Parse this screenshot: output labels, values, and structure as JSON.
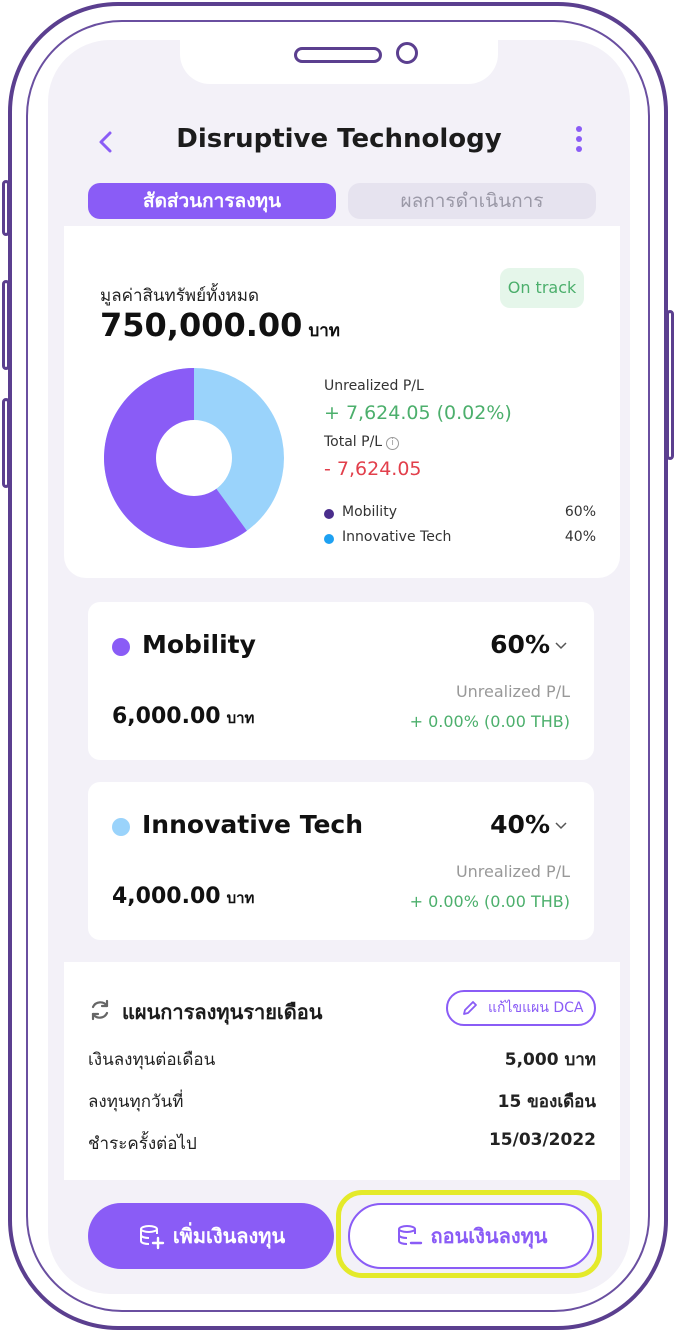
{
  "header": {
    "title": "Disruptive Technology"
  },
  "tabs": [
    {
      "label": "สัดส่วนการลงทุน",
      "active": true
    },
    {
      "label": "ผลการดำเนินการ",
      "active": false
    }
  ],
  "summary": {
    "total_label": "มูลค่าสินทรัพย์ทั้งหมด",
    "total_value": "750,000.00",
    "total_unit": "บาท",
    "status": "On track",
    "unrealized_label": "Unrealized P/L",
    "unrealized_value": "+ 7,624.05 (0.02%)",
    "total_pl_label": "Total P/L",
    "total_pl_value": "- 7,624.05",
    "legend": [
      {
        "name": "Mobility",
        "percent": "60%",
        "color": "#8a5cf6"
      },
      {
        "name": "Innovative Tech",
        "percent": "40%",
        "color": "#9ad3fb"
      }
    ],
    "donut_shares": [
      0.6,
      0.4
    ]
  },
  "assets": [
    {
      "name": "Mobility",
      "percent": "60%",
      "value": "6,000.00",
      "unit": "บาท",
      "pl_label": "Unrealized P/L",
      "pl_value": "+ 0.00% (0.00 THB)",
      "color": "#8a5cf6"
    },
    {
      "name": "Innovative Tech",
      "percent": "40%",
      "value": "4,000.00",
      "unit": "บาท",
      "pl_label": "Unrealized P/L",
      "pl_value": "+ 0.00% (0.00 THB)",
      "color": "#9ad3fb"
    }
  ],
  "plan": {
    "title": "แผนการลงทุนรายเดือน",
    "edit_label": "แก้ไขแผน DCA",
    "rows": [
      {
        "key": "เงินลงทุนต่อเดือน",
        "value": "5,000 บาท"
      },
      {
        "key": "ลงทุนทุกวันที่",
        "value": "15 ของเดือน"
      },
      {
        "key": "ชำระครั้งต่อไป",
        "value": "15/03/2022"
      }
    ]
  },
  "actions": {
    "invest_label": "เพิ่มเงินลงทุน",
    "withdraw_label": "ถอนเงินลงทุน"
  },
  "colors": {
    "accent": "#8a5cf6",
    "positive": "#4caf6c",
    "negative": "#e23f4b",
    "highlight": "#e4ea2a"
  }
}
